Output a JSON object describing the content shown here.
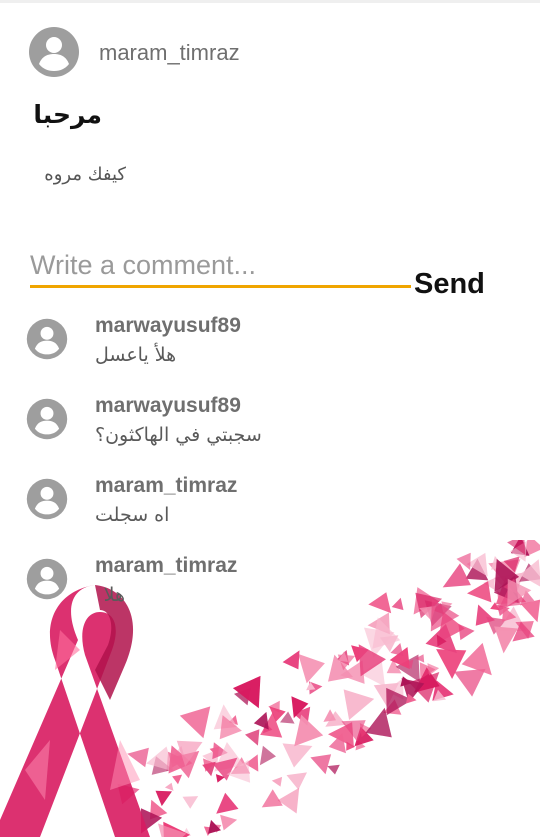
{
  "post": {
    "author": "maram_timraz",
    "title": "مرحبا",
    "body": "كيفك مروه"
  },
  "comment_box": {
    "placeholder": "Write a comment...",
    "send_label": "Send",
    "accent_color": "#f0a500"
  },
  "comments": [
    {
      "user": "marwayusuf89",
      "text": "هلأ ياعسل"
    },
    {
      "user": "marwayusuf89",
      "text": "سجبتي في الهاكثون؟"
    },
    {
      "user": "maram_timraz",
      "text": "اه سجلت"
    },
    {
      "user": "maram_timraz",
      "text": "هلا"
    }
  ],
  "background": {
    "illustration": "pink-ribbon-with-triangle-confetti",
    "ribbon_color": "#d81b60",
    "confetti_color": "#e85a95"
  },
  "icons": {
    "avatar": "person-avatar-icon"
  }
}
